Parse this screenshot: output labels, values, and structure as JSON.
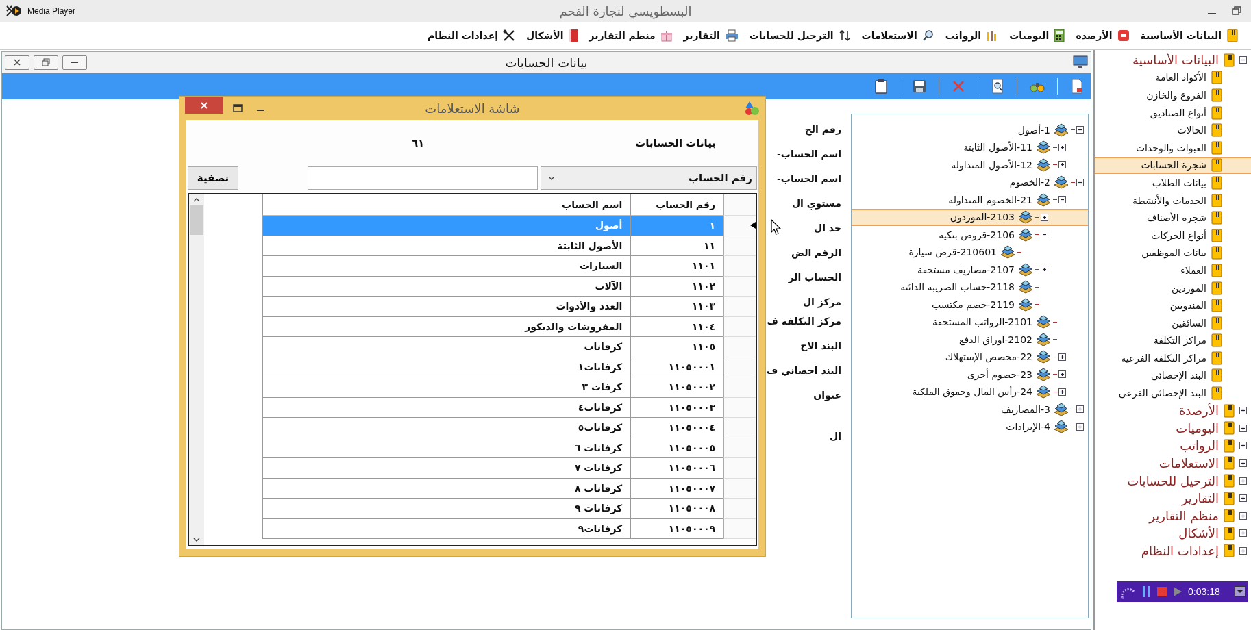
{
  "title_bar": {
    "app_name": "Media Player",
    "title": "البسطويسي لتجارة الفحم"
  },
  "menu": [
    "البيانات الأساسية",
    "الأرصدة",
    "اليوميات",
    "الرواتب",
    "الاستعلامات",
    "الترحيل للحسابات",
    "التقارير",
    "منظم التقارير",
    "الأشكال",
    "إعدادات النظام"
  ],
  "window": {
    "title": "بيانات الحسابات"
  },
  "form_labels": [
    "رقم الح",
    "اسم الحساب-",
    "اسم الحساب-",
    "مستوي ال",
    "حد ال",
    "الرقم الض",
    "الحساب الر",
    "مركز ال",
    "مركز التكلفة ف",
    "البند الاح",
    "البند احصاني ف",
    "عنوان",
    "ال"
  ],
  "tree": {
    "items": [
      {
        "label": "1-أصول",
        "expanded": true,
        "selected": false,
        "children": [
          {
            "label": "11-الأصول الثابتة",
            "expanded": false,
            "selected": false
          },
          {
            "label": "12-الأصول المتداولة",
            "expanded": false,
            "selected": false
          }
        ]
      },
      {
        "label": "2-الخصوم",
        "expanded": true,
        "selected": false,
        "children": [
          {
            "label": "21-الخصوم المتداولة",
            "expanded": true,
            "selected": false,
            "children": [
              {
                "label": "2103-الموردون",
                "expanded": false,
                "selected": true
              },
              {
                "label": "2106-قروض بنكية",
                "expanded": true,
                "selected": false,
                "children": [
                  {
                    "label": "210601-قرض سيارة",
                    "selected": false
                  }
                ]
              },
              {
                "label": "2107-مصاريف مستحقة",
                "expanded": false,
                "selected": false
              },
              {
                "label": "2118-حساب الضريبة الدائنة",
                "selected": false
              },
              {
                "label": "2119-خصم مكتسب",
                "selected": false
              }
            ]
          },
          {
            "label": "2101-الرواتب المستحقة",
            "selected": false
          },
          {
            "label": "2102-اوراق الدفع",
            "selected": false
          },
          {
            "label": "22-مخصص الإستهلاك",
            "expanded": false,
            "selected": false
          },
          {
            "label": "23-خصوم أخرى",
            "expanded": false,
            "selected": false
          },
          {
            "label": "24-رأس المال وحقوق الملكية",
            "expanded": false,
            "selected": false
          }
        ]
      },
      {
        "label": "3-المصاريف",
        "expanded": false,
        "selected": false
      },
      {
        "label": "4-الإيرادات",
        "expanded": false,
        "selected": false
      }
    ]
  },
  "dialog": {
    "title": "شاشة الاستعلامات",
    "heading": "بيانات الحسابات",
    "count": "٦١",
    "filter": {
      "field": "رقم الحساب",
      "button": "تصفية"
    },
    "table": {
      "columns": [
        "رقم الحساب",
        "اسم  الحساب"
      ],
      "rows": [
        {
          "number": "١",
          "name": "أصول",
          "selected": true
        },
        {
          "number": "١١",
          "name": "الأصول الثابتة",
          "selected": false
        },
        {
          "number": "١١٠١",
          "name": "السيارات",
          "selected": false
        },
        {
          "number": "١١٠٢",
          "name": "الآلات",
          "selected": false
        },
        {
          "number": "١١٠٣",
          "name": "العدد والأدوات",
          "selected": false
        },
        {
          "number": "١١٠٤",
          "name": "المفروشات والديكور",
          "selected": false
        },
        {
          "number": "١١٠٥",
          "name": "كرفانات",
          "selected": false
        },
        {
          "number": "١١٠٥٠٠٠١",
          "name": "كرفانات١",
          "selected": false
        },
        {
          "number": "١١٠٥٠٠٠٢",
          "name": "كرفات ٣",
          "selected": false
        },
        {
          "number": "١١٠٥٠٠٠٣",
          "name": "كرفانات٤",
          "selected": false
        },
        {
          "number": "١١٠٥٠٠٠٤",
          "name": "كرفانات٥",
          "selected": false
        },
        {
          "number": "١١٠٥٠٠٠٥",
          "name": "كرفانات ٦",
          "selected": false
        },
        {
          "number": "١١٠٥٠٠٠٦",
          "name": "كرفانات ٧",
          "selected": false
        },
        {
          "number": "١١٠٥٠٠٠٧",
          "name": "كرفانات ٨",
          "selected": false
        },
        {
          "number": "١١٠٥٠٠٠٨",
          "name": "كرفانات ٩",
          "selected": false
        },
        {
          "number": "١١٠٥٠٠٠٩",
          "name": "كرفانات٩",
          "selected": false
        }
      ]
    }
  },
  "sidebar": {
    "groups": [
      {
        "label": "البيانات الأساسية",
        "expanded": true,
        "items": [
          {
            "label": "الأكواد العامة",
            "selected": false
          },
          {
            "label": "الفروع والخازن",
            "selected": false
          },
          {
            "label": "أنواع الصناديق",
            "selected": false
          },
          {
            "label": "الحالات",
            "selected": false
          },
          {
            "label": "العبوات والوحدات",
            "selected": false
          },
          {
            "label": "شجرة الحسابات",
            "selected": true
          },
          {
            "label": "بيانات الطلاب",
            "selected": false
          },
          {
            "label": "الخدمات والأنشطة",
            "selected": false
          },
          {
            "label": "شجرة الأصناف",
            "selected": false
          },
          {
            "label": "أنواع الحركات",
            "selected": false
          },
          {
            "label": "بيانات الموظفين",
            "selected": false
          },
          {
            "label": "العملاء",
            "selected": false
          },
          {
            "label": "الموردين",
            "selected": false
          },
          {
            "label": "المندوبين",
            "selected": false
          },
          {
            "label": "السائقين",
            "selected": false
          },
          {
            "label": "مراكز التكلفة",
            "selected": false
          },
          {
            "label": "مراكز التكلفة الفرعية",
            "selected": false
          },
          {
            "label": "البند الإحصائى",
            "selected": false
          },
          {
            "label": "البند الإحصائى الفرعى",
            "selected": false
          }
        ]
      },
      {
        "label": "الأرصدة",
        "expanded": false
      },
      {
        "label": "اليوميات",
        "expanded": false
      },
      {
        "label": "الرواتب",
        "expanded": false
      },
      {
        "label": "الاستعلامات",
        "expanded": false
      },
      {
        "label": "الترحيل للحسابات",
        "expanded": false
      },
      {
        "label": "التقارير",
        "expanded": false
      },
      {
        "label": "منظم التقارير",
        "expanded": false
      },
      {
        "label": "الأشكال",
        "expanded": false
      },
      {
        "label": "إعدادات النظام",
        "expanded": false
      }
    ]
  },
  "media": {
    "time": "0:03:18"
  }
}
